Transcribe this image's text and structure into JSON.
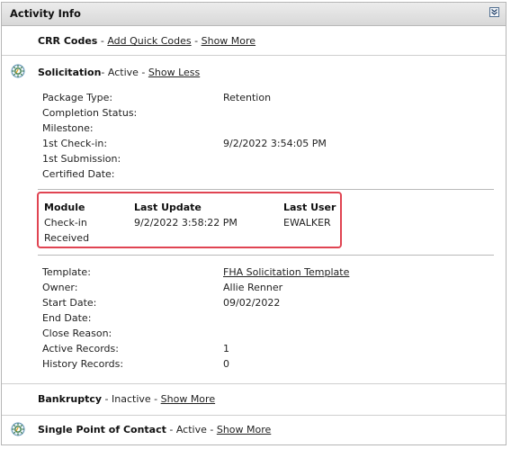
{
  "header": {
    "title": "Activity Info",
    "collapse_icon": "chevron-down-icon"
  },
  "crr": {
    "title": "CRR Codes",
    "add_link": "Add Quick Codes",
    "show_link": "Show More",
    "separator": "-"
  },
  "solicitation": {
    "title": "Solicitation",
    "status": "- Active -",
    "toggle_link": "Show Less",
    "fields": [
      {
        "label": "Package Type:",
        "value": "Retention"
      },
      {
        "label": "Completion Status:",
        "value": ""
      },
      {
        "label": "Milestone:",
        "value": ""
      },
      {
        "label": "1st Check-in:",
        "value": "9/2/2022 3:54:05 PM"
      },
      {
        "label": "1st Submission:",
        "value": ""
      },
      {
        "label": "Certified Date:",
        "value": ""
      }
    ],
    "modules": {
      "headers": [
        "Module",
        "Last Update",
        "Last User"
      ],
      "rows": [
        {
          "module_line1": "Check-in",
          "module_line2": "Received",
          "last_update": "9/2/2022 3:58:22 PM",
          "last_user": "EWALKER"
        }
      ]
    },
    "details": [
      {
        "label": "Template:",
        "value": "FHA Solicitation Template",
        "is_link": true
      },
      {
        "label": "Owner:",
        "value": "Allie Renner"
      },
      {
        "label": "Start Date:",
        "value": "09/02/2022"
      },
      {
        "label": "End Date:",
        "value": ""
      },
      {
        "label": "Close Reason:",
        "value": ""
      },
      {
        "label": "Active Records:",
        "value": "1"
      },
      {
        "label": "History Records:",
        "value": "0"
      }
    ]
  },
  "bankruptcy": {
    "title": "Bankruptcy",
    "status": "- Inactive -",
    "show_link": "Show More"
  },
  "spoc": {
    "title": "Single Point of Contact",
    "status": "- Active -",
    "show_link": "Show More"
  },
  "colors": {
    "highlight_border": "#e04452",
    "header_bg": "#e2e2e2"
  }
}
